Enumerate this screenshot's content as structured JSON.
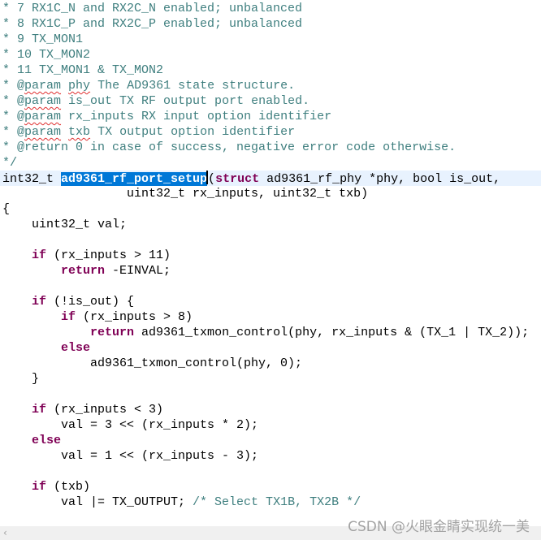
{
  "editor": {
    "current_line": 11,
    "caret_after_selection": true,
    "colors": {
      "comment": "#3f7f7f",
      "keyword": "#7f0055",
      "selection": "#0078d7",
      "current_line_bg": "#e8f2fe"
    },
    "lines": [
      [
        [
          "c",
          "* 7 RX1C_N and RX2C_N enabled; unbalanced"
        ]
      ],
      [
        [
          "c",
          "* 8 RX1C_P and RX2C_P enabled; unbalanced"
        ]
      ],
      [
        [
          "c",
          "* 9 TX_MON1"
        ]
      ],
      [
        [
          "c",
          "* 10 TX_MON2"
        ]
      ],
      [
        [
          "c",
          "* 11 TX_MON1 & TX_MON2"
        ]
      ],
      [
        [
          "c",
          "* @"
        ],
        [
          "sq",
          "param"
        ],
        [
          "c",
          " "
        ],
        [
          "sq",
          "phy"
        ],
        [
          "c",
          " The AD9361 state structure."
        ]
      ],
      [
        [
          "c",
          "* @"
        ],
        [
          "sq",
          "param"
        ],
        [
          "c",
          " is_out TX RF output port enabled."
        ]
      ],
      [
        [
          "c",
          "* @"
        ],
        [
          "sq",
          "param"
        ],
        [
          "c",
          " rx_inputs RX input option identifier"
        ]
      ],
      [
        [
          "c",
          "* @"
        ],
        [
          "sq",
          "param"
        ],
        [
          "c",
          " "
        ],
        [
          "sq",
          "txb"
        ],
        [
          "c",
          " TX output option identifier"
        ]
      ],
      [
        [
          "c",
          "* @return 0 in case of success, negative error code otherwise."
        ]
      ],
      [
        [
          "c",
          "*/"
        ]
      ],
      [
        [
          "n",
          "int32_t "
        ],
        [
          "s",
          "ad9361_rf_port_setup"
        ],
        [
          "n",
          "("
        ],
        [
          "k",
          "struct"
        ],
        [
          "n",
          " ad9361_rf_phy *phy, bool is_out,"
        ]
      ],
      [
        [
          "n",
          "                 uint32_t rx_inputs, uint32_t txb)"
        ]
      ],
      [
        [
          "n",
          "{"
        ]
      ],
      [
        [
          "n",
          "    uint32_t val;"
        ]
      ],
      [],
      [
        [
          "n",
          "    "
        ],
        [
          "k",
          "if"
        ],
        [
          "n",
          " (rx_inputs > 11)"
        ]
      ],
      [
        [
          "n",
          "        "
        ],
        [
          "k",
          "return"
        ],
        [
          "n",
          " -EINVAL;"
        ]
      ],
      [],
      [
        [
          "n",
          "    "
        ],
        [
          "k",
          "if"
        ],
        [
          "n",
          " (!is_out) {"
        ]
      ],
      [
        [
          "n",
          "        "
        ],
        [
          "k",
          "if"
        ],
        [
          "n",
          " (rx_inputs > 8)"
        ]
      ],
      [
        [
          "n",
          "            "
        ],
        [
          "k",
          "return"
        ],
        [
          "n",
          " ad9361_txmon_control(phy, rx_inputs & (TX_1 | TX_2));"
        ]
      ],
      [
        [
          "n",
          "        "
        ],
        [
          "k",
          "else"
        ]
      ],
      [
        [
          "n",
          "            ad9361_txmon_control(phy, 0);"
        ]
      ],
      [
        [
          "n",
          "    }"
        ]
      ],
      [],
      [
        [
          "n",
          "    "
        ],
        [
          "k",
          "if"
        ],
        [
          "n",
          " (rx_inputs < 3)"
        ]
      ],
      [
        [
          "n",
          "        val = 3 << (rx_inputs * 2);"
        ]
      ],
      [
        [
          "n",
          "    "
        ],
        [
          "k",
          "else"
        ]
      ],
      [
        [
          "n",
          "        val = 1 << (rx_inputs - 3);"
        ]
      ],
      [],
      [
        [
          "n",
          "    "
        ],
        [
          "k",
          "if"
        ],
        [
          "n",
          " (txb)"
        ]
      ],
      [
        [
          "n",
          "        val |= TX_OUTPUT; "
        ],
        [
          "c",
          "/* Select TX1B, TX2B */"
        ]
      ]
    ]
  },
  "scrollbar": {
    "left_arrow_icon": "chevron-left-icon",
    "left_arrow": "‹"
  },
  "watermark": "CSDN @火眼金睛实现统一美"
}
